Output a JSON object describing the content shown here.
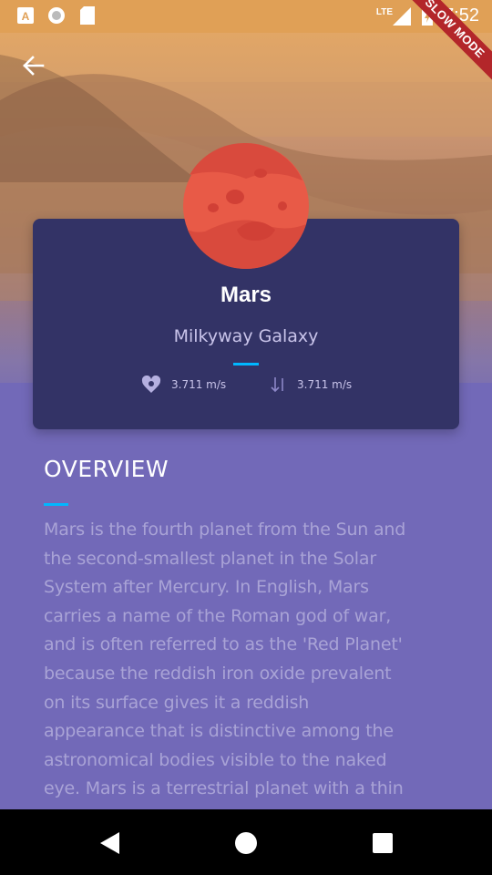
{
  "status_bar": {
    "time": "7:52",
    "network": "LTE",
    "left_icons": [
      "text-notification-icon",
      "circle-record-icon",
      "sd-card-icon"
    ],
    "right_icons": [
      "signal-icon",
      "battery-charging-icon"
    ]
  },
  "debug_banner": "SLOW MODE",
  "planet": {
    "name": "Mars",
    "location": "Milkyway Galaxy",
    "gravity": "3.711 m/s",
    "speed": "3.711 m/s"
  },
  "overview": {
    "title": "OVERVIEW",
    "lines": [
      "Mars is the fourth planet from the Sun and",
      "the second-smallest planet in the Solar",
      "System after Mercury. In English, Mars",
      "carries a name of the Roman god of war,",
      "and is often referred to as the 'Red Planet'",
      "because the reddish iron oxide prevalent",
      "on its surface gives it a reddish",
      "appearance that is distinctive among the",
      "astronomical bodies visible to the naked",
      "eye. Mars is a terrestrial planet with a thin"
    ]
  },
  "colors": {
    "card": "#333366",
    "content_background": "#7269b8",
    "accent": "#00b7ff",
    "planet": "#e85a47"
  }
}
